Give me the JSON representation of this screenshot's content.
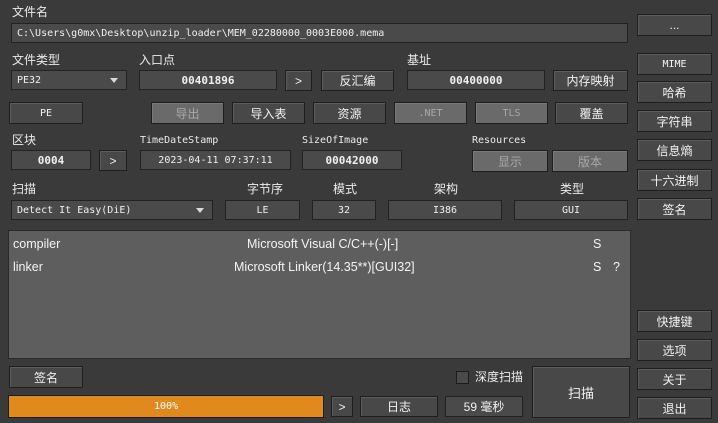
{
  "file": {
    "label": "文件名",
    "path": "C:\\Users\\g0mx\\Desktop\\unzip_loader\\MEM_02280000_0003E000.mema",
    "browse_label": "..."
  },
  "filetype": {
    "label": "文件类型",
    "value": "PE32"
  },
  "entry": {
    "label": "入口点",
    "value": "00401896",
    "go_label": ">",
    "disasm_label": "反汇编"
  },
  "base": {
    "label": "基址",
    "value": "00400000",
    "memmap_label": "内存映射"
  },
  "buttons": {
    "pe": "PE",
    "export": "导出",
    "import": "导入表",
    "resources": "资源",
    "net": ".NET",
    "tls": "TLS",
    "overlay": "覆盖"
  },
  "section": {
    "label": "区块",
    "value": "0004",
    "go_label": ">"
  },
  "timestamp": {
    "label": "TimeDateStamp",
    "value": "2023-04-11 07:37:11"
  },
  "sizeofimage": {
    "label": "SizeOfImage",
    "value": "00042000"
  },
  "resources": {
    "label": "Resources",
    "show_label": "显示",
    "version_label": "版本"
  },
  "scan": {
    "label": "扫描",
    "engine": "Detect It Easy(DiE)",
    "endian_label": "字节序",
    "endian": "LE",
    "mode_label": "模式",
    "mode": "32",
    "arch_label": "架构",
    "arch": "I386",
    "type_label": "类型",
    "type": "GUI"
  },
  "results": [
    {
      "kind": "compiler",
      "name": "Microsoft Visual C/C++(-)[-]",
      "flag": "S",
      "extra": ""
    },
    {
      "kind": "linker",
      "name": "Microsoft Linker(14.35**)[GUI32]",
      "flag": "S",
      "extra": "?"
    }
  ],
  "bottom": {
    "signature_label": "签名",
    "progress_percent": 100,
    "progress_text": "100%",
    "more_label": ">",
    "log_label": "日志",
    "time_text": "59 毫秒",
    "deep_scan_label": "深度扫描",
    "deep_scan_checked": false,
    "scan_label": "扫描"
  },
  "side": {
    "mime": "MIME",
    "hash": "哈希",
    "strings": "字符串",
    "entropy": "信息熵",
    "hex": "十六进制",
    "signatures": "签名",
    "shortcuts": "快捷键",
    "options": "选项",
    "about": "关于",
    "exit": "退出"
  },
  "colors": {
    "accent": "#e08a1e",
    "background": "#3a3a3a",
    "panel": "#5e5e5e"
  }
}
